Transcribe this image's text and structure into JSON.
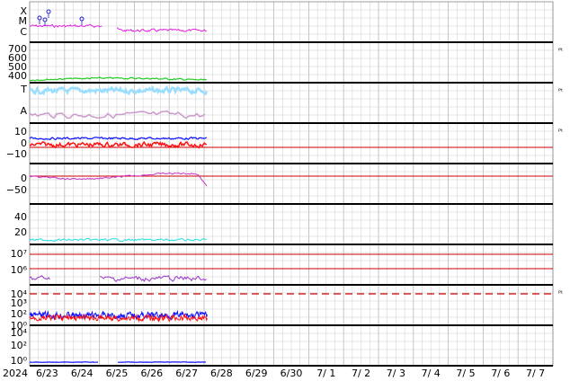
{
  "colors": {
    "xray": "#e020e0",
    "proton": "#22cc22",
    "mag_total": "#99ddff",
    "mag_dim": "#cc99cc",
    "bz": "#ff1010",
    "bt": "#1010ff",
    "ref": "#cc0000",
    "psi": "#cc33cc",
    "density": "#22dddd",
    "electron": "#9933cc",
    "grid": "#cccccc",
    "divider": "#000000"
  },
  "chart_data": {
    "type": "line",
    "title": "",
    "x_axis": {
      "first_label": "2024",
      "dates": [
        "6/23",
        "6/24",
        "6/25",
        "6/26",
        "6/27",
        "6/28",
        "6/29",
        "6/30",
        "7/ 1",
        "7/ 2",
        "7/ 3",
        "7/ 4",
        "7/ 5",
        "7/ 6",
        "7/ 7"
      ],
      "data_end_date": "6/27"
    },
    "grid": true,
    "panels": [
      {
        "id": "xray",
        "y_labels": [
          "X",
          "M",
          "C"
        ],
        "right_marker": "",
        "series": [
          {
            "color_key": "xray"
          }
        ]
      },
      {
        "id": "proton",
        "y_labels": [
          "700",
          "600",
          "500",
          "400"
        ],
        "right_marker": "ᴾᵗ",
        "series": [
          {
            "color_key": "proton",
            "approx_value": 400
          }
        ]
      },
      {
        "id": "mag",
        "y_labels": [
          "T",
          "A"
        ],
        "right_marker": "ᴾᵗ",
        "series": [
          {
            "color_key": "mag_total"
          },
          {
            "color_key": "mag_dim"
          }
        ]
      },
      {
        "id": "bfield",
        "y_labels": [
          "10",
          "0",
          "−10"
        ],
        "right_marker": "ᴾᵗ",
        "reference_value": 0,
        "series": [
          {
            "color_key": "bt"
          },
          {
            "color_key": "bz"
          }
        ]
      },
      {
        "id": "angle",
        "y_labels": [
          "0",
          "−50"
        ],
        "right_marker": "",
        "reference_value": 0,
        "series": [
          {
            "color_key": "psi"
          }
        ]
      },
      {
        "id": "density",
        "y_labels": [
          "40",
          "20"
        ],
        "right_marker": "",
        "series": [
          {
            "color_key": "density"
          }
        ]
      },
      {
        "id": "electron",
        "y_labels": [
          "10⁷",
          "10⁶"
        ],
        "right_marker": "",
        "reference_lines": [
          "10⁷",
          "10⁶"
        ],
        "series": [
          {
            "color_key": "electron"
          }
        ]
      },
      {
        "id": "proton_flux",
        "y_labels": [
          "10⁴",
          "10³",
          "10²",
          "10⁰"
        ],
        "right_marker": "ᴾᵗ",
        "reference_value": "10⁴",
        "series": [
          {
            "color_key": "bt"
          },
          {
            "color_key": "bz"
          }
        ]
      },
      {
        "id": "xray_flux",
        "y_labels": [
          "10⁴",
          "10²",
          "10⁰"
        ],
        "right_marker": "",
        "series": [
          {
            "color_key": "bt"
          }
        ]
      }
    ]
  }
}
